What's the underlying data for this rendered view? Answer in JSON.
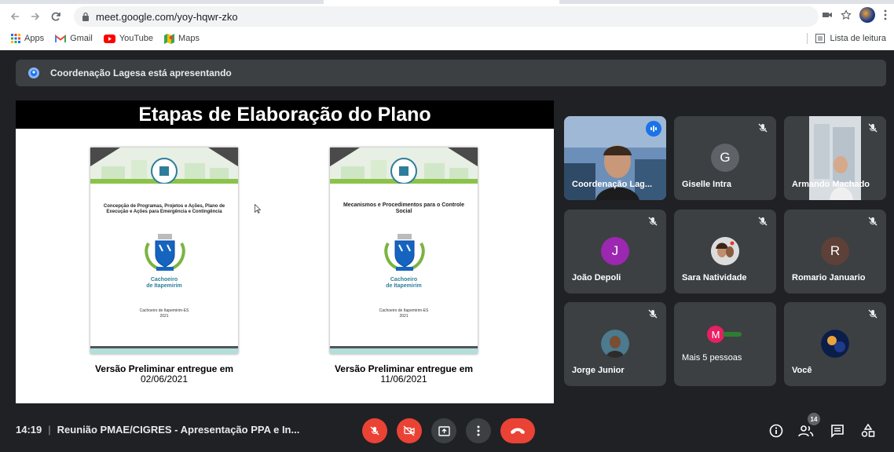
{
  "browser": {
    "url": "meet.google.com/yoy-hqwr-zko",
    "bookmarks": [
      {
        "label": "Apps"
      },
      {
        "label": "Gmail"
      },
      {
        "label": "YouTube"
      },
      {
        "label": "Maps"
      }
    ],
    "reading_list": "Lista de leitura"
  },
  "meet": {
    "presenting_text": "Coordenação Lagesa está apresentando",
    "slide": {
      "title": "Etapas de Elaboração do Plano",
      "docs": [
        {
          "title": "Concepção de Programas, Projetos e Ações, Plano de Execução e Ações para Emergência e Contingência",
          "city_line1": "Cachoeiro",
          "city_line2": "de Itapemirim",
          "place_line1": "Cachoeiro de Itapemirim-ES",
          "place_line2": "2021",
          "caption_line1": "Versão Preliminar entregue em",
          "caption_line2": "02/06/2021"
        },
        {
          "title": "Mecanismos e Procedimentos para o Controle Social",
          "city_line1": "Cachoeiro",
          "city_line2": "de Itapemirim",
          "place_line1": "Cachoeiro de Itapemirim-ES",
          "place_line2": "2021",
          "caption_line1": "Versão Preliminar entregue em",
          "caption_line2": "11/06/2021"
        }
      ]
    },
    "participants": [
      {
        "name": "Coordenação Lag...",
        "type": "video"
      },
      {
        "name": "Giselle Intra",
        "initial": "G",
        "color": "#5f6368"
      },
      {
        "name": "Armando Machado",
        "type": "video"
      },
      {
        "name": "João Depoli",
        "initial": "J",
        "color": "#9c27b0"
      },
      {
        "name": "Sara Natividade",
        "type": "photo"
      },
      {
        "name": "Romario Januario",
        "initial": "R",
        "color": "#5d4037"
      },
      {
        "name": "Jorge Junior",
        "type": "photo"
      },
      {
        "name": "Mais 5 pessoas",
        "initial": "M",
        "color": "#e91e63"
      },
      {
        "name": "Você",
        "type": "photo"
      }
    ],
    "bottom": {
      "time": "14:19",
      "meeting_title": "Reunião PMAE/CIGRES - Apresentação PPA e In...",
      "people_count": "14"
    },
    "colors": {
      "end_call": "#ea4335",
      "background": "#202124",
      "tile": "#3c4043",
      "accent": "#8ab4f8"
    }
  }
}
